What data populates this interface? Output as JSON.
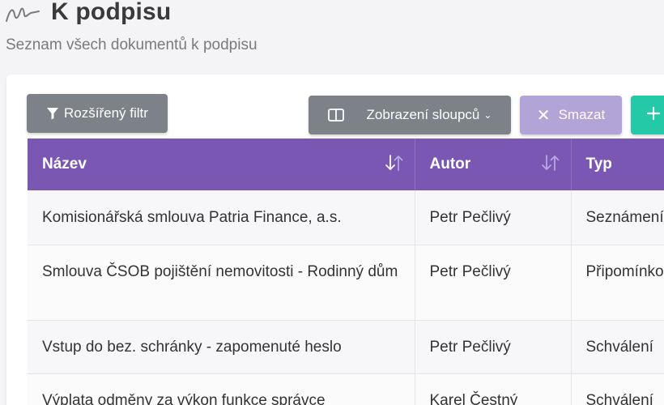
{
  "header": {
    "title": "K podpisu",
    "subtitle": "Seznam všech dokumentů k podpisu",
    "logo_icon": "signature-icon"
  },
  "toolbar": {
    "filter_label": "Rozšířený filtr",
    "filter_icon": "funnel-icon",
    "columns_label": "Zobrazení sloupců",
    "columns_icon": "columns-icon",
    "delete_label": "Smazat",
    "delete_icon": "close-icon",
    "add_icon": "plus-icon",
    "colors": {
      "neutral": "#7c8288",
      "delete": "#b3a4d8",
      "add": "#24c9a8",
      "header": "#7a57b3"
    }
  },
  "table": {
    "columns": [
      {
        "label": "Název",
        "sortable": true,
        "sort": "descending"
      },
      {
        "label": "Autor",
        "sortable": true,
        "sort": "none"
      },
      {
        "label": "Typ"
      }
    ],
    "rows": [
      {
        "nazev": "Komisionářská smlouva Patria Finance, a.s.",
        "autor": "Petr Pečlivý",
        "typ": "Seznámení"
      },
      {
        "nazev": "Smlouva ČSOB pojištění nemovitosti - Rodinný dům",
        "autor": "Petr Pečlivý",
        "typ": "Připomínko"
      },
      {
        "nazev": "Vstup do bez. schránky - zapomenuté heslo",
        "autor": "Petr Pečlivý",
        "typ": "Schválení"
      },
      {
        "nazev": "Výplata odměny za výkon funkce správce",
        "autor": "Karel Čestný",
        "typ": "Schválení"
      }
    ]
  }
}
